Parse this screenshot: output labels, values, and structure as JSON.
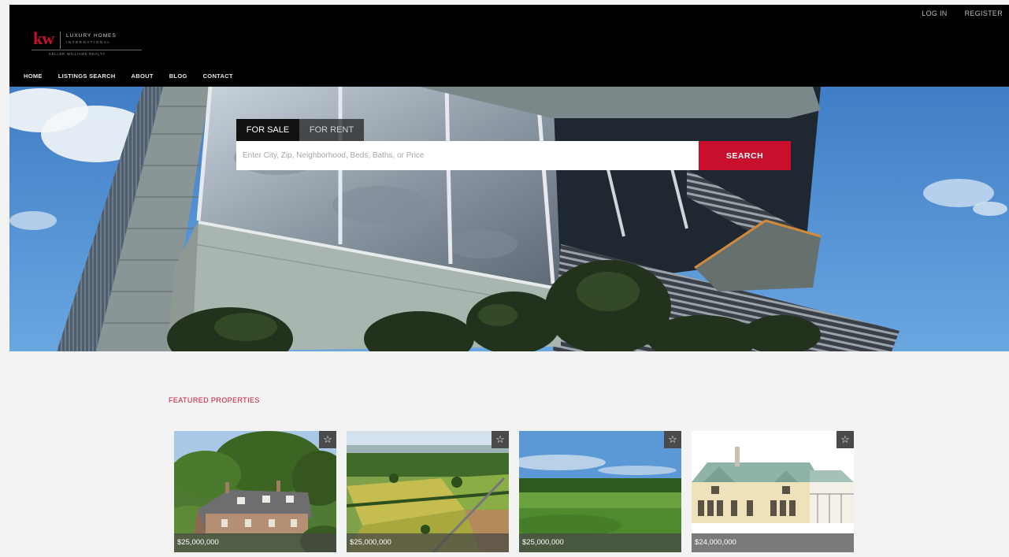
{
  "top_links": {
    "login": "LOG IN",
    "register": "REGISTER"
  },
  "logo": {
    "mark": "kw",
    "line1": "LUXURY HOMES",
    "line2": "INTERNATIONAL",
    "line3": "KELLER WILLIAMS REALTY"
  },
  "nav": [
    "HOME",
    "LISTINGS SEARCH",
    "ABOUT",
    "BLOG",
    "CONTACT"
  ],
  "search": {
    "tabs": [
      "FOR SALE",
      "FOR RENT"
    ],
    "placeholder": "Enter City, Zip, Neighborhood, Beds, Baths, or Price",
    "button": "SEARCH"
  },
  "featured": {
    "title": "FEATURED PROPERTIES",
    "cards": [
      {
        "price": "$25,000,000",
        "image": "manor-in-forest"
      },
      {
        "price": "$25,000,000",
        "image": "aerial-farmland"
      },
      {
        "price": "$25,000,000",
        "image": "green-pasture"
      },
      {
        "price": "$24,000,000",
        "image": "chateau-drawing"
      }
    ]
  },
  "icons": {
    "favorite": "star-outline-icon"
  },
  "colors": {
    "brand_red": "#c8102e",
    "header_bg": "#000000",
    "page_bg": "#f3f3f3"
  }
}
